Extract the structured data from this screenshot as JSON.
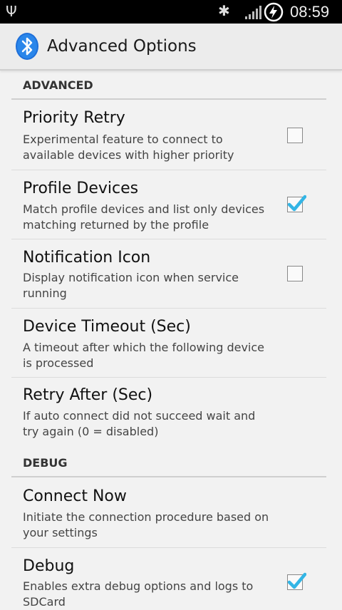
{
  "status_bar": {
    "time": "08:59",
    "icons": [
      "usb-icon",
      "bluetooth-icon",
      "signal-icon",
      "charging-icon"
    ]
  },
  "action_bar": {
    "title": "Advanced Options",
    "icon": "bluetooth-app-icon"
  },
  "sections": [
    {
      "header": "ADVANCED",
      "items": [
        {
          "title": "Priority Retry",
          "summary": "Experimental feature to connect to available devices with higher priority",
          "checked": false
        },
        {
          "title": "Profile Devices",
          "summary": "Match profile devices and list only devices matching returned by the profile",
          "checked": true
        },
        {
          "title": "Notification Icon",
          "summary": "Display notification icon when service running",
          "checked": false
        },
        {
          "title": "Device Timeout (Sec)",
          "summary": "A timeout after which the following device is processed"
        },
        {
          "title": "Retry After (Sec)",
          "summary": "If auto connect did not succeed wait and try again (0 = disabled)"
        }
      ]
    },
    {
      "header": "DEBUG",
      "items": [
        {
          "title": "Connect Now",
          "summary": "Initiate the connection procedure based on your settings"
        },
        {
          "title": "Debug",
          "summary": "Enables extra debug options and logs to SDCard",
          "checked": true
        }
      ]
    }
  ],
  "colors": {
    "accent": "#33b5e5",
    "background": "#f2f2f2",
    "action_bar": "#ececec",
    "status_bar": "#000000"
  }
}
